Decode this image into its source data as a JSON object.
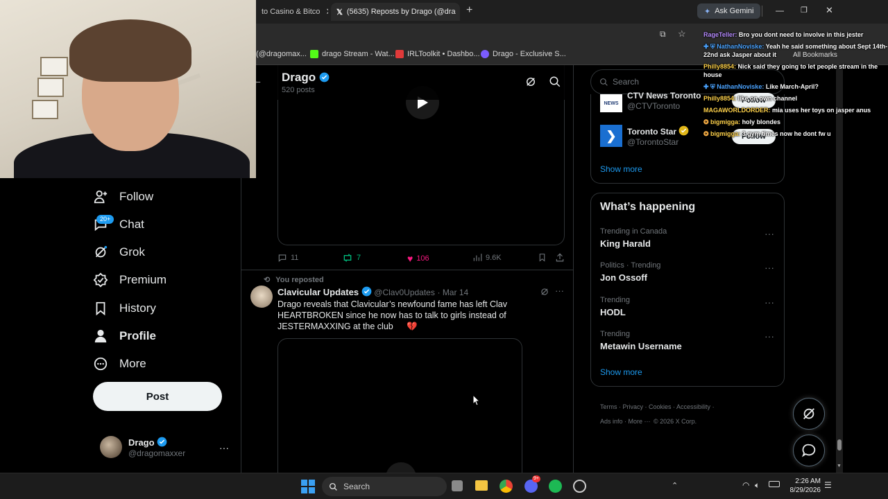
{
  "browser": {
    "tabs": [
      {
        "label": "to Casino & Bitco"
      },
      {
        "label": "(5635) Reposts by Drago (@dra"
      }
    ],
    "new_tab": "+",
    "ask_gemini": "Ask Gemini",
    "bookmarks": [
      {
        "label": "(@dragomax..."
      },
      {
        "label": "drago Stream - Wat..."
      },
      {
        "label": "IRLToolkit • Dashbo..."
      },
      {
        "label": "Drago - Exclusive S..."
      }
    ],
    "all_bookmarks": "All Bookmarks"
  },
  "sidebar": {
    "items": [
      {
        "label": "Follow",
        "icon": "follow-icon"
      },
      {
        "label": "Chat",
        "icon": "chat-icon",
        "badge": "20+"
      },
      {
        "label": "Grok",
        "icon": "grok-icon"
      },
      {
        "label": "Premium",
        "icon": "premium-icon"
      },
      {
        "label": "History",
        "icon": "bookmark-icon"
      },
      {
        "label": "Profile",
        "icon": "profile-icon"
      },
      {
        "label": "More",
        "icon": "more-icon"
      }
    ],
    "post_label": "Post",
    "account": {
      "name": "Drago",
      "handle": "@dragomaxxer",
      "menu": "···"
    }
  },
  "profile_header": {
    "name": "Drago",
    "posts": "520 posts"
  },
  "post1": {
    "replies": "11",
    "reposts": "7",
    "likes": "106",
    "views": "9.6K"
  },
  "post2": {
    "reposted_label": "You reposted",
    "author": "Clavicular Updates",
    "handle": "@Clav0Updates",
    "date": "· Mar 14",
    "text_line1": "Drago reveals that Clavicular’s newfound fame has left Clav",
    "text_line2": "HEARTBROKEN since he now has to talk to girls instead of",
    "text_line3": "JESTERMAXXING at the club",
    "emoji": "💔",
    "menu": "···"
  },
  "right": {
    "search_placeholder": "Search",
    "who_to_follow": [
      {
        "name": "CTV News Toronto",
        "handle": "@CTVToronto",
        "logo": "NEWS",
        "follow": "Follow"
      },
      {
        "name": "Toronto Star",
        "handle": "@TorontoStar",
        "follow": "Follow"
      }
    ],
    "show_more_1": "Show more",
    "whats_happening_title": "What’s happening",
    "trends": [
      {
        "meta": "Trending in Canada",
        "name": "King Harald"
      },
      {
        "meta": "Politics · Trending",
        "name": "Jon Ossoff"
      },
      {
        "meta": "Trending",
        "name": "HODL"
      },
      {
        "meta": "Trending",
        "name": "Metawin Username"
      }
    ],
    "show_more_2": "Show more",
    "footer": {
      "links": [
        "Terms",
        "Privacy",
        "Cookies",
        "Accessibility",
        "Ads info",
        "More ···"
      ],
      "copyright": "© 2026 X Corp."
    }
  },
  "chat": [
    {
      "user": "RageTeller:",
      "color": "#b78cff",
      "text": "Bro you dont need to involve in this jester"
    },
    {
      "user": "NathanNoviske:",
      "color": "#4aa3ff",
      "text": "Yeah he said something about Sept 14th-22nd ask Jasper about it"
    },
    {
      "user": "Philly8854:",
      "color": "#ffd24a",
      "text": "Nick said they going to let people stream in the house"
    },
    {
      "user": "NathanNoviske:",
      "color": "#4aa3ff",
      "text": "Like March-April?"
    },
    {
      "user": "Philly8854:",
      "color": "#ffd24a",
      "text": "like on own channel"
    },
    {
      "user": "MAGAWORLDORDER:",
      "color": "#ffd24a",
      "text": "mia uses her toys on jasper anus"
    },
    {
      "user": "bigmigga:",
      "color": "#ffd24a",
      "text": "holy blondes"
    },
    {
      "user": "bigmigga:",
      "color": "#ffd24a",
      "text": "3 gym times now he dont fw u"
    }
  ],
  "taskbar": {
    "search": "Search",
    "time": "2:26 AM",
    "date": "8/29/2026",
    "discord_badge": "9+"
  }
}
